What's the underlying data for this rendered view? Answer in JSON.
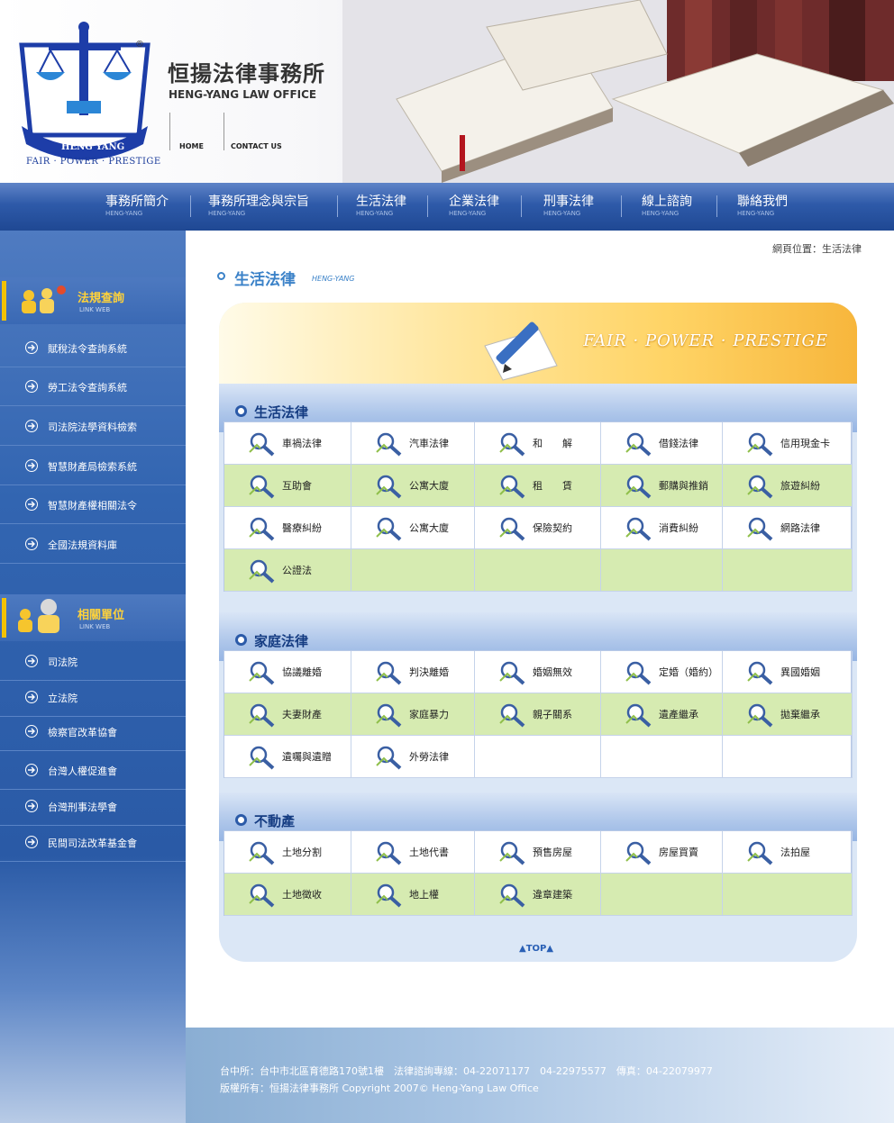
{
  "header": {
    "brand_cn": "恒揚法律事務所",
    "brand_en": "HENG-YANG LAW OFFICE",
    "tagline": "FAIR · POWER · PRESTIGE",
    "logo_text": "HENG YANG",
    "logo_mark": "®",
    "links": {
      "home": "HOME",
      "contact": "CONTACT US"
    }
  },
  "nav": [
    {
      "label": "事務所簡介",
      "sub": "HENG-YANG"
    },
    {
      "label": "事務所理念與宗旨",
      "sub": "HENG-YANG"
    },
    {
      "label": "生活法律",
      "sub": "HENG-YANG"
    },
    {
      "label": "企業法律",
      "sub": "HENG-YANG"
    },
    {
      "label": "刑事法律",
      "sub": "HENG-YANG"
    },
    {
      "label": "線上諮詢",
      "sub": "HENG-YANG"
    },
    {
      "label": "聯絡我們",
      "sub": "HENG-YANG"
    }
  ],
  "sidebar": {
    "group1": {
      "title": "法規查詢",
      "sub": "LINK WEB",
      "items": [
        "賦稅法令查詢系統",
        "勞工法令查詢系統",
        "司法院法學資料檢索",
        "智慧財產局檢索系統",
        "智慧財產權相關法令",
        "全國法規資料庫"
      ]
    },
    "group2": {
      "title": "相關單位",
      "sub": "LINK WEB",
      "items": [
        "司法院",
        "立法院",
        "檢察官改革協會",
        "台灣人權促進會",
        "台灣刑事法學會",
        "民間司法改革基金會"
      ]
    }
  },
  "content": {
    "breadcrumb": "網頁位置：生活法律",
    "title": "生活法律",
    "title_en": "HENG-YANG",
    "banner": "FAIR · POWER · PRESTIGE",
    "sections": [
      {
        "title": "生活法律",
        "rows": [
          [
            "車禍法律",
            "汽車法律",
            "和　　解",
            "借錢法律",
            "信用現金卡"
          ],
          [
            "互助會",
            "公寓大廈",
            "租　　賃",
            "郵購與推銷",
            "旅遊糾紛"
          ],
          [
            "醫療糾紛",
            "公寓大廈",
            "保險契約",
            "消費糾紛",
            "網路法律"
          ],
          [
            "公證法",
            "",
            "",
            "",
            ""
          ]
        ]
      },
      {
        "title": "家庭法律",
        "rows": [
          [
            "協議離婚",
            "判決離婚",
            "婚姻無效",
            "定婚（婚約）",
            "異國婚姻"
          ],
          [
            "夫妻財產",
            "家庭暴力",
            "親子關系",
            "遺產繼承",
            "拋棄繼承"
          ],
          [
            "遺囑與遺贈",
            "外勞法律",
            "",
            "",
            ""
          ]
        ]
      },
      {
        "title": "不動產",
        "rows": [
          [
            "土地分割",
            "土地代書",
            "預售房屋",
            "房屋買賣",
            "法拍屋"
          ],
          [
            "土地徵收",
            "地上權",
            "違章建築",
            "",
            ""
          ]
        ]
      }
    ],
    "top": "▲TOP▲"
  },
  "footer": {
    "line1": "台中所：台中市北區育德路170號1樓　法律諮詢專線：04-22071177　04-22975577　傳真：04-22079977",
    "line2": "版權所有：恒揚法律事務所  Copyright 2007© Heng-Yang Law Office"
  },
  "colors": {
    "nav_blue": "#2e5aa9",
    "title_blue": "#3b82c8",
    "row_green": "#d6ebb1",
    "sidebar_yellow": "#ffd23a"
  }
}
